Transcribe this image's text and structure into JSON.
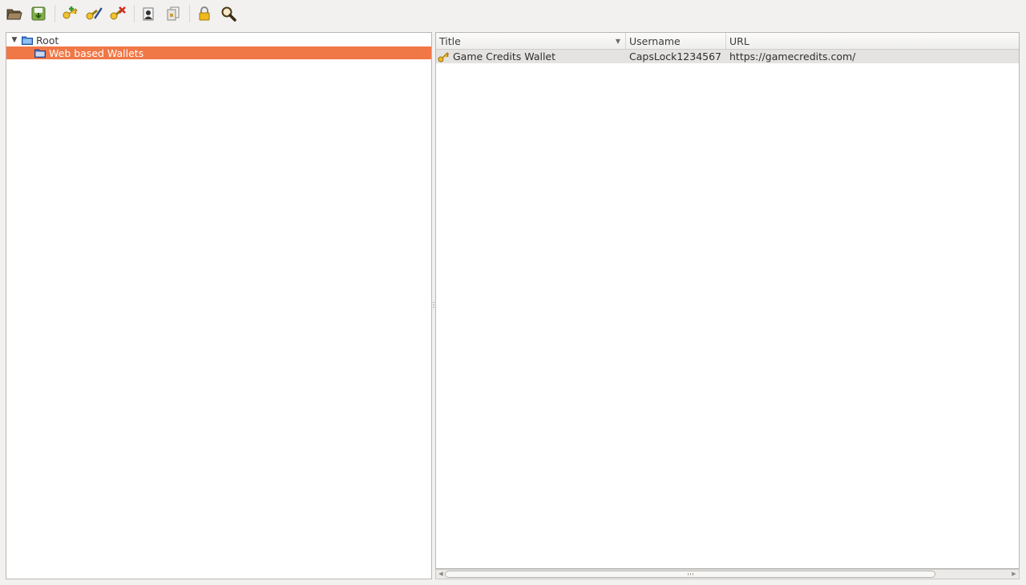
{
  "toolbar": {
    "buttons": [
      {
        "id": "open",
        "icon": "folder-open-icon"
      },
      {
        "id": "save",
        "icon": "save-icon"
      },
      {
        "id": "add-entry",
        "icon": "key-add-icon"
      },
      {
        "id": "edit-entry",
        "icon": "key-edit-icon"
      },
      {
        "id": "delete-entry",
        "icon": "key-delete-icon"
      },
      {
        "id": "copy-username",
        "icon": "copy-username-icon"
      },
      {
        "id": "copy-password",
        "icon": "copy-password-icon"
      },
      {
        "id": "lock",
        "icon": "lock-icon"
      },
      {
        "id": "search",
        "icon": "search-icon"
      }
    ]
  },
  "tree": {
    "root_label": "Root",
    "groups": [
      {
        "label": "Web based Wallets",
        "selected": true
      }
    ]
  },
  "entries": {
    "columns": [
      {
        "label": "Title",
        "sort": "descending"
      },
      {
        "label": "Username"
      },
      {
        "label": "URL"
      }
    ],
    "rows": [
      {
        "title": "Game Credits Wallet",
        "username": "CapsLock1234567",
        "url": "https://gamecredits.com/"
      }
    ]
  },
  "colors": {
    "selection": "#f07746",
    "row_highlight": "#e4e3e1",
    "background": "#f2f1f0"
  }
}
